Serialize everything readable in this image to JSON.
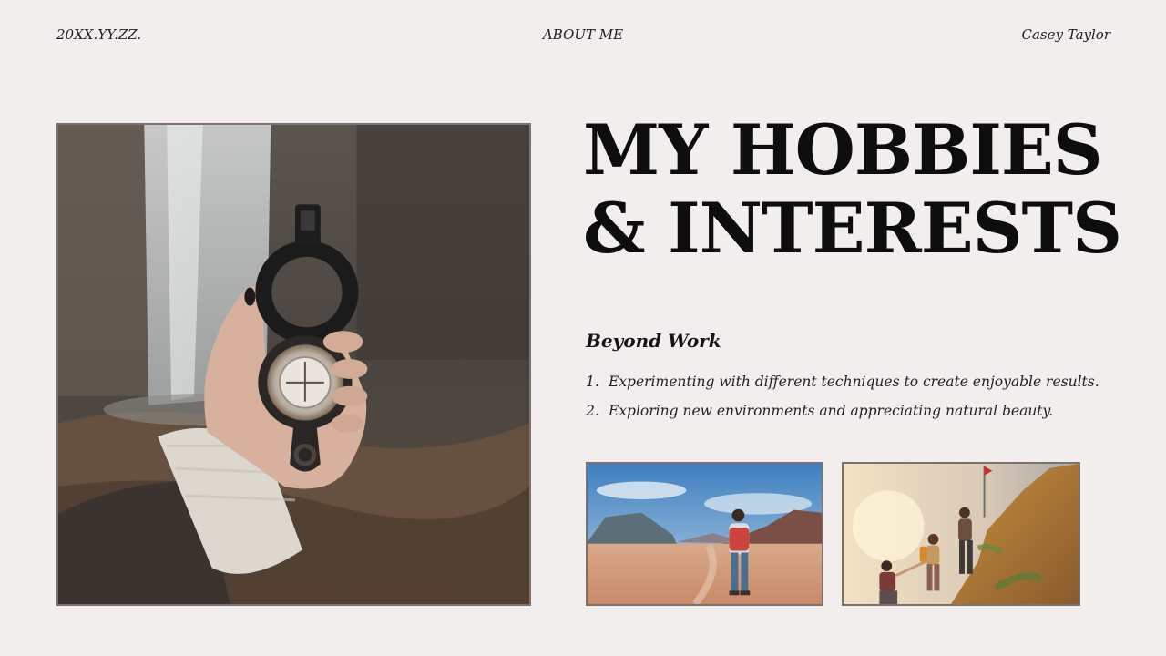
{
  "header": {
    "date": "20XX.YY.ZZ.",
    "section": "ABOUT ME",
    "author": "Casey Taylor"
  },
  "title": {
    "line1": "MY HOBBIES",
    "line2": "& INTERESTS"
  },
  "subtitle": "Beyond Work",
  "list": [
    {
      "num": "1.",
      "text": "Experimenting with different techniques to create enjoyable results."
    },
    {
      "num": "2.",
      "text": "Exploring new environments and appreciating natural beauty."
    }
  ],
  "colors": {
    "background": "#f2eeed",
    "text": "#111111",
    "photo_border": "#7b7270"
  },
  "images": {
    "main": "hand-holding-compass-waterfall-photo",
    "small_left": "hiker-in-desert-photo",
    "small_right": "climbers-on-cliff-photo"
  }
}
